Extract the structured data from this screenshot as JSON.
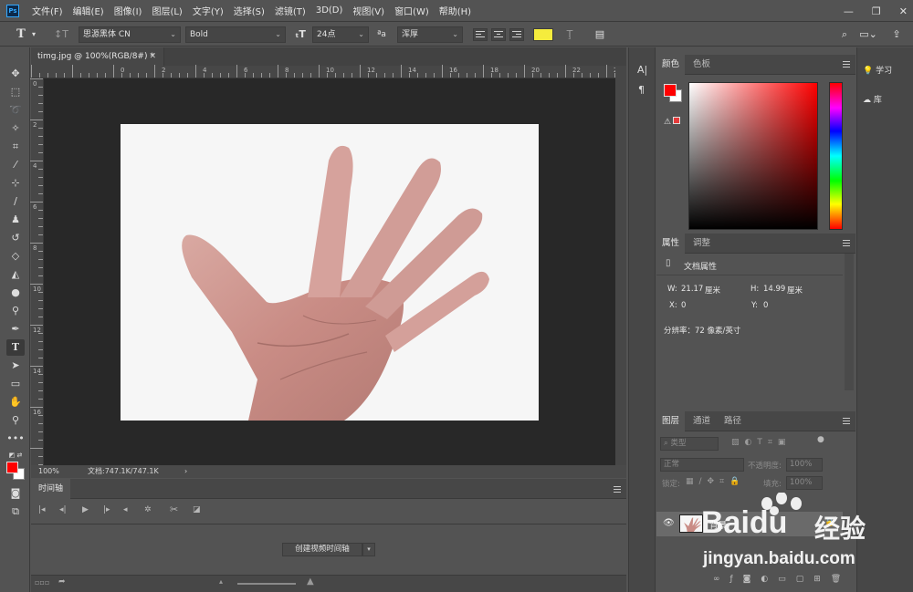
{
  "app": {
    "logo": "Ps"
  },
  "menu": [
    "文件(F)",
    "编辑(E)",
    "图像(I)",
    "图层(L)",
    "文字(Y)",
    "选择(S)",
    "滤镜(T)",
    "3D(D)",
    "视图(V)",
    "窗口(W)",
    "帮助(H)"
  ],
  "options": {
    "font_family": "思源黑体 CN",
    "font_style": "Bold",
    "font_size": "24点",
    "aa_label": "ªa",
    "antialias": "浑厚",
    "text_color": "#f5ec3d"
  },
  "document": {
    "tab_title": "timg.jpg @ 100%(RGB/8#) *",
    "zoom": "100%",
    "doc_info": "文档:747.1K/747.1K"
  },
  "ruler": {
    "top": [
      "0",
      "2",
      "4",
      "6",
      "8",
      "10",
      "12",
      "14",
      "16",
      "18",
      "20",
      "22",
      "24"
    ],
    "left": [
      "0",
      "2",
      "4",
      "6",
      "8",
      "10",
      "12",
      "14",
      "16"
    ]
  },
  "timeline": {
    "tab": "时间轴",
    "create_button": "创建视频时间轴"
  },
  "color_panel": {
    "tabs": [
      "颜色",
      "色板"
    ],
    "fg": "#ff0000",
    "bg": "#ffffff"
  },
  "properties": {
    "tabs": [
      "属性",
      "调整"
    ],
    "section": "文档属性",
    "w_label": "W:",
    "w_value": "21.17",
    "w_unit": "厘米",
    "h_label": "H:",
    "h_value": "14.99",
    "h_unit": "厘米",
    "x_label": "X:",
    "x_value": "0",
    "y_label": "Y:",
    "y_value": "0",
    "resolution": "分辨率：72 像素/英寸"
  },
  "layers": {
    "tabs": [
      "图层",
      "通道",
      "路径"
    ],
    "filter": "类型",
    "blend_mode": "正常",
    "opacity_label": "不透明度:",
    "opacity": "100%",
    "lock_label": "锁定:",
    "fill_label": "填充:",
    "fill": "100%",
    "layer_name": "背景"
  },
  "far_right": {
    "learn": "学习",
    "library": "库"
  },
  "watermark": {
    "brand": "Baidu",
    "cn": "经验",
    "url": "jingyan.baidu.com"
  }
}
